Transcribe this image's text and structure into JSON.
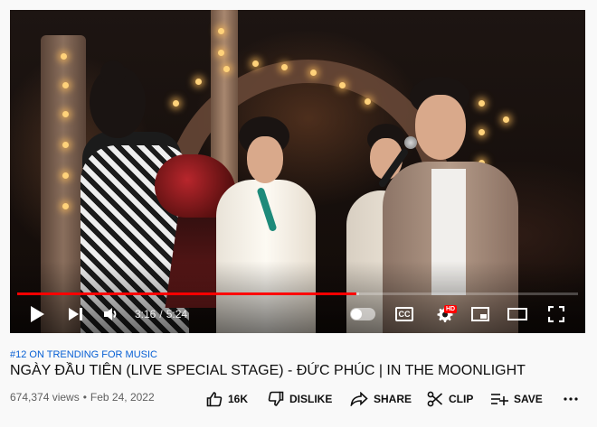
{
  "player": {
    "current_time": "3:16",
    "separator": "/",
    "duration": "5:24",
    "progress_fraction": 0.605,
    "buffered_fraction": 0.61,
    "autoplay_on": false,
    "cc_label": "CC",
    "hd_badge": "HD",
    "accent_color": "#ff0000"
  },
  "video": {
    "trending": "#12 ON TRENDING FOR MUSIC",
    "title": "NGÀY ĐẦU TIÊN (LIVE SPECIAL STAGE) - ĐỨC PHÚC | IN THE MOONLIGHT",
    "views": "674,374 views",
    "dot": "•",
    "date": "Feb 24, 2022"
  },
  "actions": {
    "like": "16K",
    "dislike": "DISLIKE",
    "share": "SHARE",
    "clip": "CLIP",
    "save": "SAVE"
  },
  "icons": {
    "play": "play-icon",
    "next": "next-icon",
    "volume": "volume-icon",
    "settings": "gear-icon",
    "miniplayer": "miniplayer-icon",
    "theater": "theater-icon",
    "fullscreen": "fullscreen-icon",
    "like": "thumbs-up-icon",
    "dislike": "thumbs-down-icon",
    "share": "share-arrow-icon",
    "clip": "scissors-icon",
    "save": "playlist-add-icon",
    "more": "more-dots-icon"
  }
}
